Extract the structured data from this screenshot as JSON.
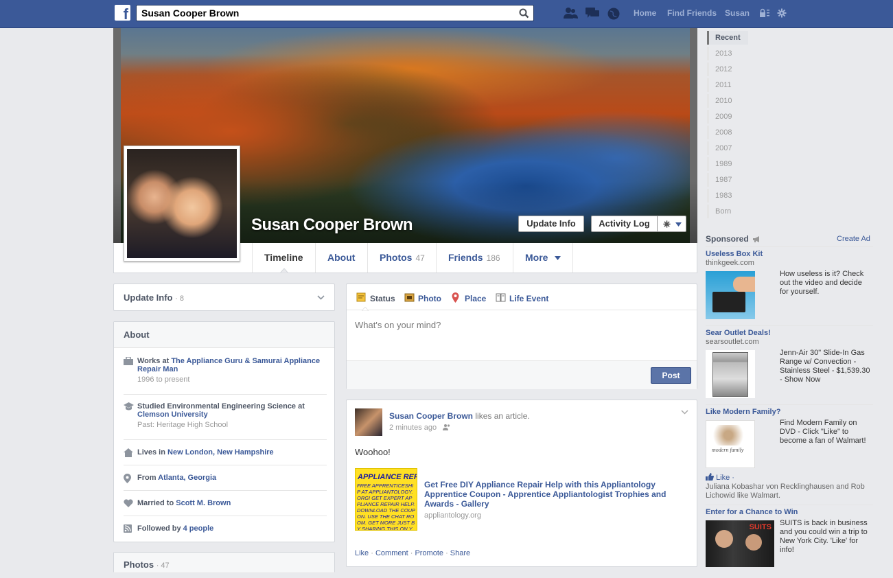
{
  "topbar": {
    "logo_letter": "f",
    "search_value": "Susan Cooper Brown",
    "nav": [
      "Home",
      "Find Friends",
      "Susan"
    ]
  },
  "profile": {
    "name": "Susan Cooper Brown",
    "update_info_btn": "Update Info",
    "activity_log_btn": "Activity Log"
  },
  "tabs": [
    {
      "label": "Timeline",
      "count": ""
    },
    {
      "label": "About",
      "count": ""
    },
    {
      "label": "Photos",
      "count": "47"
    },
    {
      "label": "Friends",
      "count": "186"
    },
    {
      "label": "More",
      "count": ""
    }
  ],
  "update_info": {
    "label": "Update Info",
    "count": "· 8"
  },
  "about": {
    "title": "About",
    "work": {
      "prefix": "Works at ",
      "link": "The Appliance Guru & Samurai Appliance Repair Man",
      "sub": "1996 to present"
    },
    "study": {
      "prefix": "Studied Environmental Engineering Science at ",
      "link": "Clemson University",
      "sub": "Past: Heritage High School"
    },
    "lives": {
      "prefix": "Lives in ",
      "link": "New London, New Hampshire"
    },
    "from": {
      "prefix": "From ",
      "link": "Atlanta, Georgia"
    },
    "married": {
      "prefix": "Married to ",
      "link": "Scott M. Brown"
    },
    "followed": {
      "prefix": "Followed by ",
      "link": "4 people"
    }
  },
  "photos_box": {
    "label": "Photos",
    "count": "· 47"
  },
  "composer": {
    "tabs": [
      "Status",
      "Photo",
      "Place",
      "Life Event"
    ],
    "placeholder": "What's on your mind?",
    "post_btn": "Post"
  },
  "story": {
    "author": "Susan Cooper Brown",
    "action": "likes an article.",
    "time": "2 minutes ago",
    "text": "Woohoo!",
    "article_title": "Get Free DIY Appliance Repair Help with this Appliantology Apprentice Coupon - Apprentice Appliantologist Trophies and Awards - Gallery",
    "article_domain": "appliantology.org",
    "thumb_text": "APPLIANCE REPAIR",
    "thumb_small": "FREE APPRENTICESHIP AT APPLIANTOLOGY.ORG! GET EXPERT APPLIANCE REPAIR HELP. DOWNLOAD THE COUPON. USE THE CHAT ROOM. GET MORE JUST BY SHARING THIS ON YOUR FACEBOOK WALL! @ WWW.APPLIANTOLOGY.ORG",
    "actions": [
      "Like",
      "Comment",
      "Promote",
      "Share"
    ]
  },
  "timeline_years": [
    "Recent",
    "2013",
    "2012",
    "2011",
    "2010",
    "2009",
    "2008",
    "2007",
    "1989",
    "1987",
    "1983",
    "Born"
  ],
  "sponsored": {
    "label": "Sponsored",
    "create_ad": "Create Ad",
    "ads": [
      {
        "title": "Useless Box Kit",
        "host": "thinkgeek.com",
        "text": "How useless is it? Check out the video and decide for yourself."
      },
      {
        "title": "Sear Outlet Deals!",
        "host": "searsoutlet.com",
        "text": "Jenn-Air 30\" Slide-In Gas Range w/ Convection - Stainless Steel - $1,539.30 - Show Now"
      },
      {
        "title": "Like Modern Family?",
        "host": "",
        "text": "Find Modern Family on DVD - Click \"Like\" to become a fan of Walmart!",
        "like": "Like ·",
        "social": "Juliana Kobashar von Recklinghausen and Rob Lichowid like Walmart.",
        "img_text": "modern family"
      },
      {
        "title": "Enter for a Chance to Win",
        "host": "",
        "text": "SUITS is back in business and you could win a trip to New York City. 'Like' for info!",
        "img_text": "SUITS"
      }
    ]
  }
}
